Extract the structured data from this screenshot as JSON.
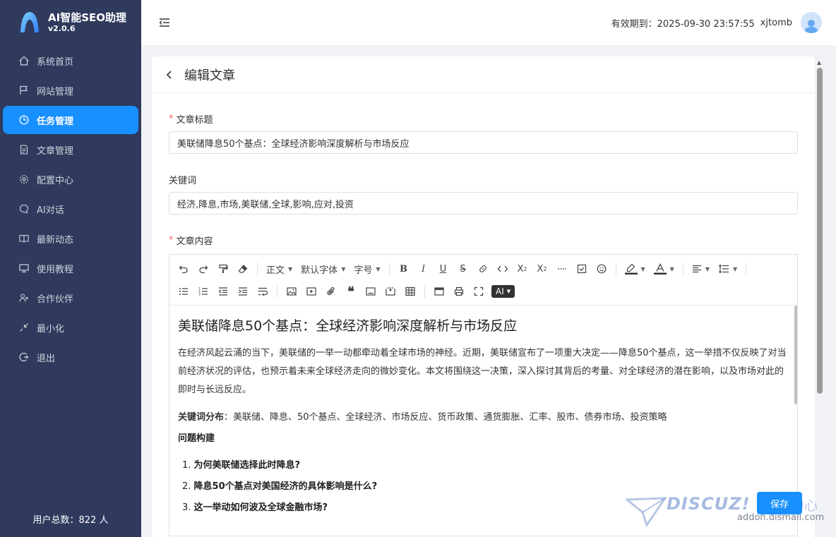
{
  "brand": {
    "name": "AI智能SEO助理",
    "version": "v2.0.6"
  },
  "menu": [
    {
      "label": "系统首页",
      "icon": "home-icon",
      "active": false
    },
    {
      "label": "网站管理",
      "icon": "flag-icon",
      "active": false
    },
    {
      "label": "任务管理",
      "icon": "clock-icon",
      "active": true
    },
    {
      "label": "文章管理",
      "icon": "document-icon",
      "active": false
    },
    {
      "label": "配置中心",
      "icon": "gear-icon",
      "active": false
    },
    {
      "label": "AI对话",
      "icon": "chat-icon",
      "active": false
    },
    {
      "label": "最新动态",
      "icon": "book-icon",
      "active": false
    },
    {
      "label": "使用教程",
      "icon": "monitor-icon",
      "active": false
    },
    {
      "label": "合作伙伴",
      "icon": "partner-icon",
      "active": false
    },
    {
      "label": "最小化",
      "icon": "minimize-icon",
      "active": false
    },
    {
      "label": "退出",
      "icon": "logout-icon",
      "active": false
    }
  ],
  "user_total": "用户总数：822 人",
  "header": {
    "expiry": "有效期到：2025-09-30 23:57:55",
    "username": "xjtomb"
  },
  "page": {
    "title": "编辑文章"
  },
  "form": {
    "title_label": "文章标题",
    "title_value": "美联储降息50个基点：全球经济影响深度解析与市场反应",
    "keywords_label": "关键词",
    "keywords_value": "经济,降息,市场,美联储,全球,影响,应对,投资",
    "content_label": "文章内容"
  },
  "toolbar": {
    "paragraph": "正文",
    "font": "默认字体",
    "size": "字号",
    "ai": "AI"
  },
  "article": {
    "heading": "美联储降息50个基点：全球经济影响深度解析与市场反应",
    "intro": "在经济风起云涌的当下，美联储的一举一动都牵动着全球市场的神经。近期，美联储宣布了一项重大决定——降息50个基点，这一举措不仅反映了对当前经济状况的评估，也预示着未来全球经济走向的微妙变化。本文将围绕这一决策，深入探讨其背后的考量、对全球经济的潜在影响，以及市场对此的即时与长远反应。",
    "kw_label": "关键词分布",
    "kw_text": "：美联储、降息、50个基点、全球经济、市场反应、货币政策、通货膨胀、汇率、股市、债券市场、投资策略",
    "section": "问题构建",
    "questions": [
      "为何美联储选择此时降息?",
      "降息50个基点对美国经济的具体影响是什么?",
      "这一举动如何波及全球金融市场?"
    ]
  },
  "save_label": "保存",
  "watermark": {
    "main": "DISCUZ!",
    "side": "应用中心",
    "url": "addon.dismall.com"
  },
  "colors": {
    "sidebar": "#2f3a5d",
    "accent": "#1890ff",
    "required": "#f56c6c"
  }
}
